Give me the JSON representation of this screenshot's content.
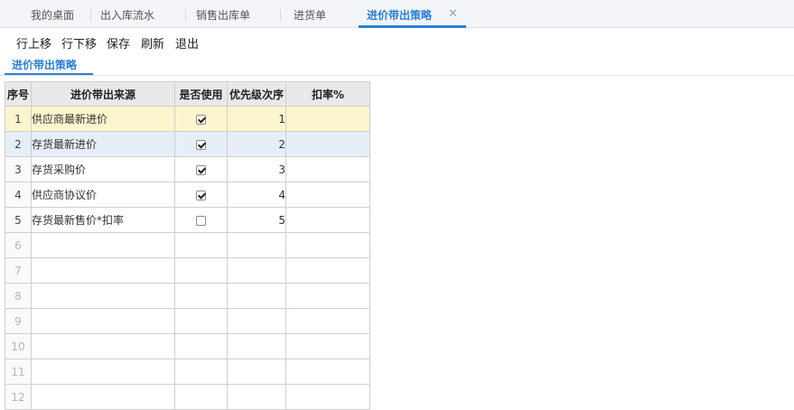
{
  "tabs": [
    {
      "label": "我的桌面",
      "active": false
    },
    {
      "label": "出入库流水",
      "active": false
    },
    {
      "label": "销售出库单",
      "active": false
    },
    {
      "label": "进货单",
      "active": false
    },
    {
      "label": "进价带出策略",
      "active": true
    }
  ],
  "tab_close_glyph": "✕",
  "toolbar": {
    "move_up": "行上移",
    "move_down": "行下移",
    "save": "保存",
    "refresh": "刷新",
    "exit": "退出"
  },
  "section_title": "进价带出策略",
  "table": {
    "headers": {
      "idx": "序号",
      "source": "进价带出来源",
      "use": "是否使用",
      "priority": "优先级次序",
      "discount": "扣率%"
    },
    "rows": [
      {
        "idx": "1",
        "source": "供应商最新进价",
        "use": true,
        "priority": "1",
        "discount": ""
      },
      {
        "idx": "2",
        "source": "存货最新进价",
        "use": true,
        "priority": "2",
        "discount": ""
      },
      {
        "idx": "3",
        "source": "存货采购价",
        "use": true,
        "priority": "3",
        "discount": ""
      },
      {
        "idx": "4",
        "source": "供应商协议价",
        "use": true,
        "priority": "4",
        "discount": ""
      },
      {
        "idx": "5",
        "source": "存货最新售价*扣率",
        "use": false,
        "priority": "5",
        "discount": ""
      }
    ],
    "empty_rows": [
      "6",
      "7",
      "8",
      "9",
      "10",
      "11",
      "12"
    ]
  },
  "colors": {
    "accent": "#2c7fd6",
    "selected_row": "#fcf5cd",
    "hover_row": "#e6eef8"
  }
}
